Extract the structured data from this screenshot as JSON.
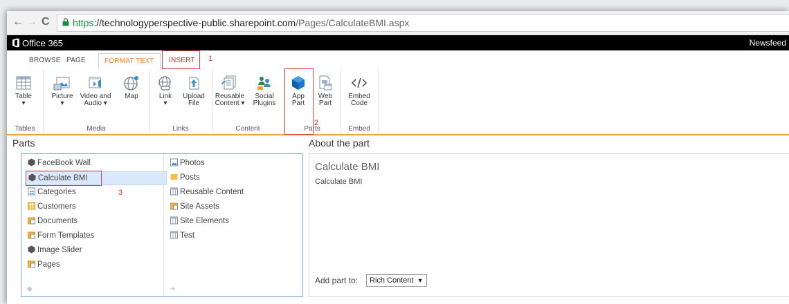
{
  "browser": {
    "url_scheme": "https",
    "url_host": "://technologyperspective-public.sharepoint.com",
    "url_path": "/Pages/CalculateBMI.aspx"
  },
  "suite": {
    "title": "Office 365",
    "right_link": "Newsfeed"
  },
  "ribbon_tabs": [
    "BROWSE",
    "PAGE",
    "FORMAT TEXT",
    "INSERT"
  ],
  "annotations": {
    "a1": "1",
    "a2": "2",
    "a3": "3"
  },
  "ribbon": {
    "groups": {
      "tables": "Tables",
      "media": "Media",
      "links": "Links",
      "content": "Content",
      "parts": "Parts",
      "embed": "Embed"
    },
    "buttons": {
      "table": "Table",
      "picture": "Picture",
      "video_1": "Video and",
      "video_2": "Audio ▾",
      "map": "Map",
      "link": "Link",
      "upload_1": "Upload",
      "upload_2": "File",
      "reusable_1": "Reusable",
      "reusable_2": "Content ▾",
      "social_1": "Social",
      "social_2": "Plugins",
      "app_1": "App",
      "app_2": "Part",
      "web_1": "Web",
      "web_2": "Part",
      "embed_1": "Embed",
      "embed_2": "Code"
    }
  },
  "parts_panel": {
    "title": "Parts",
    "left_items": [
      "FaceBook Wall",
      "Calculate BMI",
      "Categories",
      "Customers",
      "Documents",
      "Form Templates",
      "Image Slider",
      "Pages"
    ],
    "right_items": [
      "Photos",
      "Posts",
      "Reusable Content",
      "Site Assets",
      "Site Elements",
      "Test"
    ]
  },
  "about_panel": {
    "title": "About the part",
    "part_name": "Calculate BMI",
    "part_description": "Calculate BMI",
    "add_to_label": "Add part to:",
    "add_to_value": "Rich Content"
  },
  "colors": {
    "accent": "#ed7d31",
    "annotation": "#e04444",
    "selection": "#d9e9fb"
  }
}
